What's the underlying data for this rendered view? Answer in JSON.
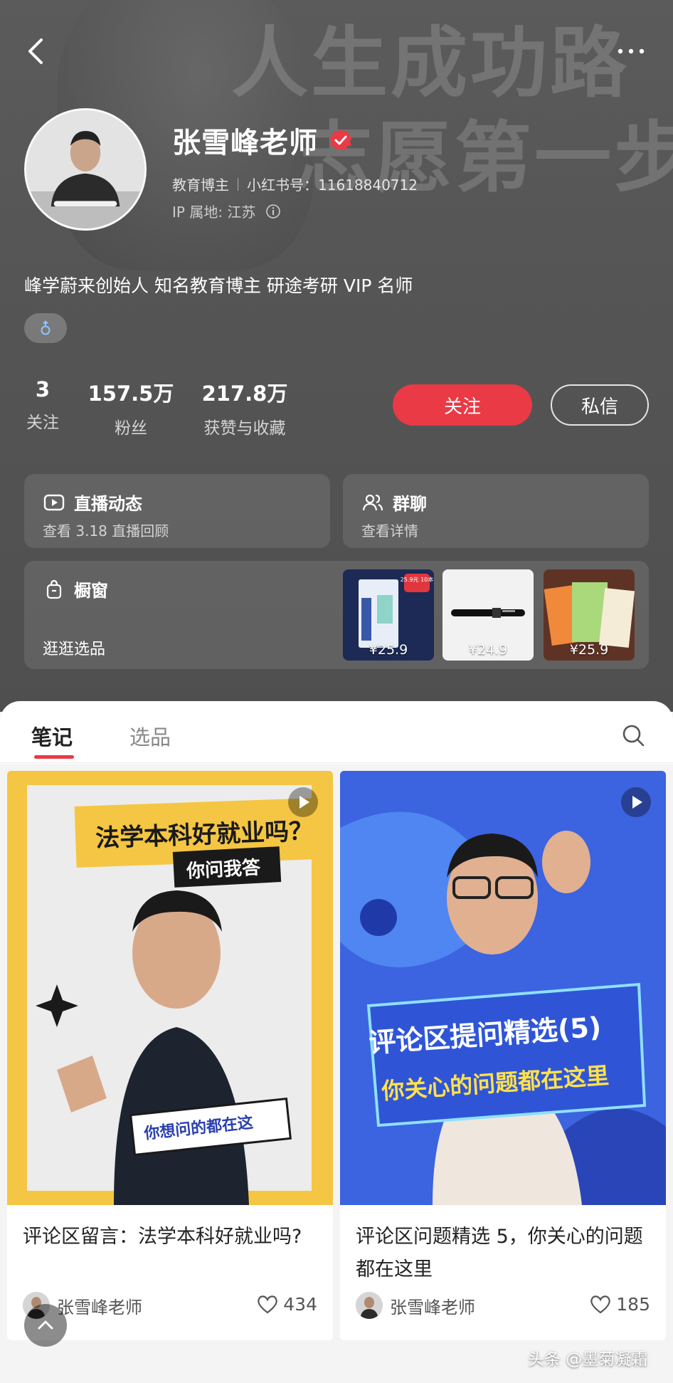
{
  "header": {
    "background_text": [
      "人生成功路",
      "志愿第一步"
    ],
    "back_icon": "chevron-left-icon",
    "more_icon": "more-horizontal-icon"
  },
  "profile": {
    "name": "张雪峰老师",
    "verified_icon": "verified-check-icon",
    "category": "教育博主",
    "account_label": "小红书号：11618840712",
    "ip_location": "IP 属地: 江苏",
    "bio": "峰学蔚来创始人 知名教育博主 研途考研 VIP 名师",
    "gender_icon": "male-icon"
  },
  "stats": [
    {
      "value": "3",
      "label": "关注"
    },
    {
      "value": "157.5万",
      "label": "粉丝"
    },
    {
      "value": "217.8万",
      "label": "获赞与收藏"
    }
  ],
  "actions": {
    "follow": "关注",
    "message": "私信"
  },
  "cards": {
    "live": {
      "title": "直播动态",
      "subtitle": "查看 3.18 直播回顾"
    },
    "group": {
      "title": "群聊",
      "subtitle": "查看详情"
    },
    "shop": {
      "title": "橱窗",
      "subtitle": "逛逛选品",
      "products": [
        {
          "price": "¥25.9",
          "badge": "25.9元 10本"
        },
        {
          "price": "¥24.9"
        },
        {
          "price": "¥25.9"
        }
      ]
    }
  },
  "tabs": [
    {
      "label": "笔记",
      "active": true
    },
    {
      "label": "选品",
      "active": false
    }
  ],
  "notes": [
    {
      "cover_text": [
        "法学本科好就业吗？",
        "你问我答",
        "你想问的都在这"
      ],
      "title": "评论区留言：法学本科好就业吗?",
      "author": "张雪峰老师",
      "likes": "434"
    },
    {
      "cover_text": [
        "评论区提问精选(5)",
        "你关心的问题都在这里"
      ],
      "title": "评论区问题精选 5，你关心的问题都在这里",
      "author": "张雪峰老师",
      "likes": "185"
    }
  ],
  "watermark": "头条 @墨菊凝霜",
  "colors": {
    "accent": "#ea3a45",
    "hero_bg": "#555555"
  }
}
